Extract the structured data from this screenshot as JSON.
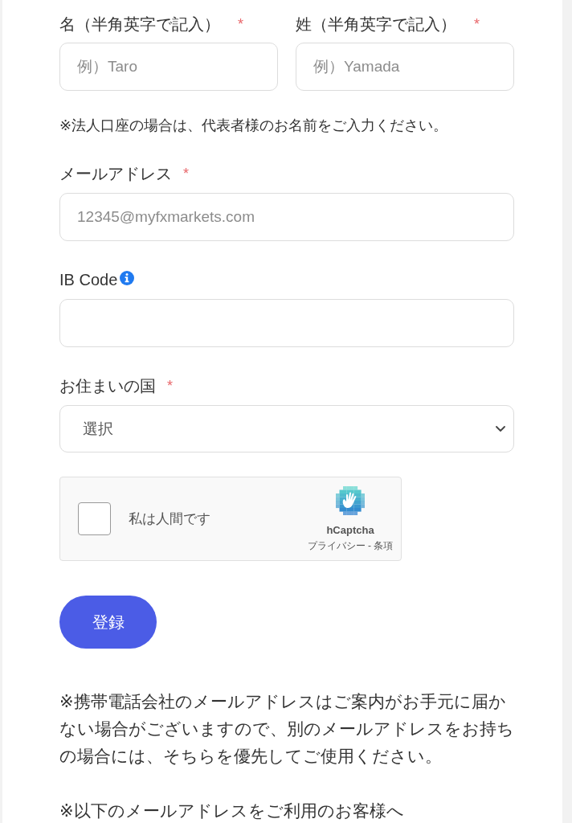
{
  "name_fields": [
    {
      "label": "名（半角英字で記入）",
      "required_mark": "*",
      "placeholder": "例）Taro"
    },
    {
      "label": "姓（半角英字で記入）",
      "required_mark": "*",
      "placeholder": "例）Yamada"
    }
  ],
  "name_note": "※法人口座の場合は、代表者様のお名前をご入力ください。",
  "fields": [
    {
      "kind": "input",
      "label": "メールアドレス",
      "required_mark": "*",
      "info": false,
      "placeholder": "12345@myfxmarkets.com"
    },
    {
      "kind": "input",
      "label": "IB Code",
      "info": true
    },
    {
      "kind": "select",
      "label": "お住まいの国",
      "required_mark": "*",
      "info": false,
      "value": "選択"
    }
  ],
  "captcha": {
    "checked": false,
    "label": "私は人間です",
    "brand": "hCaptcha",
    "links": [
      "プライバシー",
      "条項"
    ],
    "link_separator": "-"
  },
  "submit_button": {
    "label": "登録"
  },
  "notices": [
    "※携帯電話会社のメールアドレスはご案内がお手元に届かない場合がございますので、別のメールアドレスをお持ちの場合には、そちらを優先してご使用ください。",
    "※以下のメールアドレスをご利用のお客様へ"
  ]
}
